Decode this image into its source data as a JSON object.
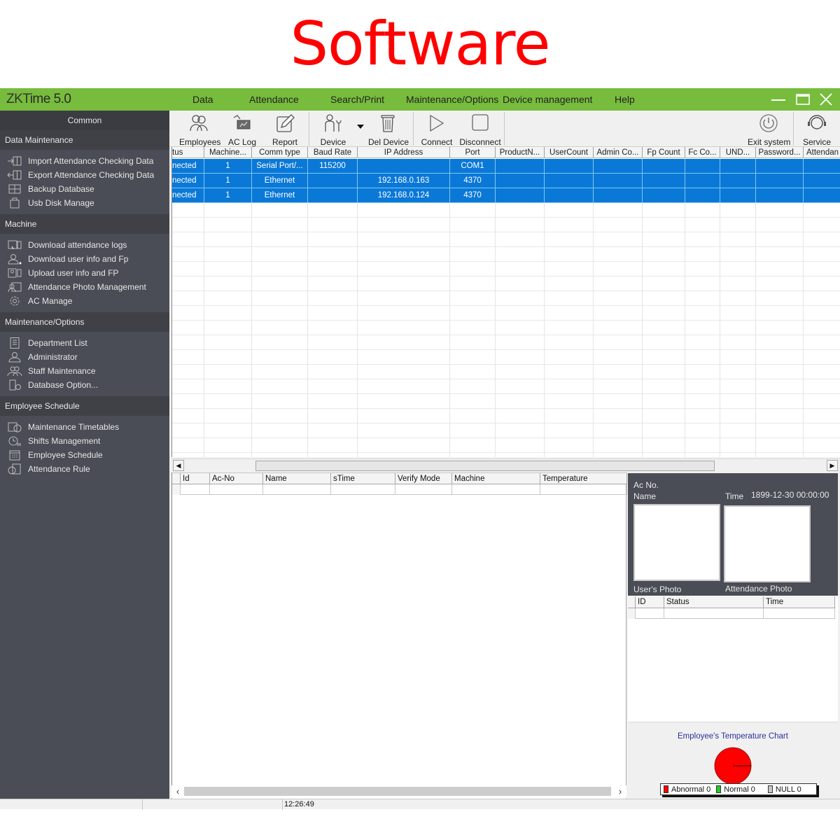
{
  "banner": {
    "title": "Software"
  },
  "app": {
    "title_prefix": "ZKT",
    "title_suffix": "ime 5.0",
    "menu": [
      "Data",
      "Attendance",
      "Search/Print",
      "Maintenance/Options",
      "Device management",
      "Help"
    ],
    "window_controls": [
      "minimize-icon",
      "maximize-icon",
      "close-icon"
    ],
    "accent_color": "#77bc3d"
  },
  "sidebar": {
    "common_label": "Common",
    "sections": [
      {
        "title": "Data Maintenance",
        "items": [
          {
            "label": "Import Attendance Checking Data",
            "icon": "import-data-icon"
          },
          {
            "label": "Export Attendance Checking Data",
            "icon": "export-data-icon"
          },
          {
            "label": "Backup Database",
            "icon": "backup-database-icon"
          },
          {
            "label": "Usb Disk Manage",
            "icon": "usb-disk-icon"
          }
        ]
      },
      {
        "title": "Machine",
        "items": [
          {
            "label": "Download attendance logs",
            "icon": "download-logs-icon"
          },
          {
            "label": "Download user info and Fp",
            "icon": "download-user-icon"
          },
          {
            "label": "Upload user info and FP",
            "icon": "upload-user-icon"
          },
          {
            "label": "Attendance Photo Management",
            "icon": "photo-management-icon"
          },
          {
            "label": "AC Manage",
            "icon": "gear-icon"
          }
        ]
      },
      {
        "title": "Maintenance/Options",
        "items": [
          {
            "label": "Department List",
            "icon": "department-list-icon"
          },
          {
            "label": "Administrator",
            "icon": "administrator-icon"
          },
          {
            "label": "Staff Maintenance",
            "icon": "staff-icon"
          },
          {
            "label": "Database Option...",
            "icon": "database-option-icon"
          }
        ]
      },
      {
        "title": "Employee Schedule",
        "items": [
          {
            "label": "Maintenance Timetables",
            "icon": "timetable-icon"
          },
          {
            "label": "Shifts Management",
            "icon": "shifts-icon"
          },
          {
            "label": "Employee Schedule",
            "icon": "calendar-icon"
          },
          {
            "label": "Attendance Rule",
            "icon": "attendance-rule-icon"
          }
        ]
      }
    ]
  },
  "toolbar": {
    "buttons": [
      {
        "label": "Employees",
        "icon": "employees-icon"
      },
      {
        "label": "AC Log",
        "icon": "ac-log-icon"
      },
      {
        "label": "Report",
        "icon": "report-icon"
      },
      {
        "label": "Device",
        "icon": "device-icon"
      },
      {
        "label": "Del Device",
        "icon": "trash-icon"
      },
      {
        "label": "Connect",
        "icon": "play-icon"
      },
      {
        "label": "Disconnect",
        "icon": "stop-icon"
      },
      {
        "label": "Exit system",
        "icon": "power-icon"
      },
      {
        "label": "Service",
        "icon": "headset-icon"
      }
    ]
  },
  "device_grid": {
    "columns": [
      "tus",
      "Machine...",
      "Comm type",
      "Baud Rate",
      "IP Address",
      "Port",
      "ProductN...",
      "UserCount",
      "Admin Co...",
      "Fp Count",
      "Fc Co...",
      "UND...",
      "Password...",
      "Attendan"
    ],
    "rows": [
      [
        "nected",
        "1",
        "Serial Port/...",
        "115200",
        "",
        "COM1",
        "",
        "",
        "",
        "",
        "",
        "",
        "",
        ""
      ],
      [
        "nected",
        "1",
        "Ethernet",
        "",
        "192.168.0.163",
        "4370",
        "",
        "",
        "",
        "",
        "",
        "",
        "",
        ""
      ],
      [
        "nected",
        "1",
        "Ethernet",
        "",
        "192.168.0.124",
        "4370",
        "",
        "",
        "",
        "",
        "",
        "",
        "",
        ""
      ]
    ],
    "selection_color": "#0a78d7"
  },
  "log_grid": {
    "columns": [
      "Id",
      "Ac-No",
      "Name",
      "sTime",
      "Verify Mode",
      "Machine",
      "Temperature"
    ]
  },
  "info_panel": {
    "ac_no_label": "Ac No.",
    "name_label": "Name",
    "time_label": "Time",
    "time_value": "1899-12-30 00:00:00",
    "user_photo_label": "User's Photo",
    "attendance_photo_label": "Attendance Photo",
    "log_columns": [
      "ID",
      "Status",
      "Time"
    ]
  },
  "chart_data": {
    "type": "pie",
    "title": "Employee's Temperature Chart",
    "categories": [
      "Abnormal",
      "Normal",
      "NULL"
    ],
    "values": [
      0,
      0,
      0
    ],
    "colors": [
      "#ff0000",
      "#22cc22",
      "#c8c8c8"
    ],
    "legend": [
      {
        "label": "Abnormal 0"
      },
      {
        "label": "Normal 0"
      },
      {
        "label": "NULL 0"
      }
    ],
    "legend_position": "bottom"
  },
  "statusbar": {
    "time": "12:26:49"
  }
}
